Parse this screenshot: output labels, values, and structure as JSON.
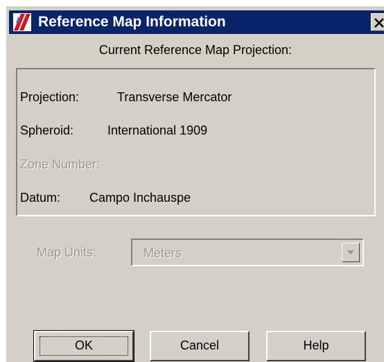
{
  "window": {
    "title": "Reference Map Information",
    "icon": "map-app-icon",
    "close_icon": "close-icon"
  },
  "heading": "Current Reference Map Projection:",
  "info": {
    "projection_label": "Projection:",
    "projection_value": "Transverse Mercator",
    "spheroid_label": "Spheroid:",
    "spheroid_value": "International 1909",
    "zone_label": "Zone Number:",
    "datum_label": "Datum:",
    "datum_value": "Campo Inchauspe"
  },
  "map_units": {
    "label": "Map Units:",
    "selected": "Meters",
    "dropdown_icon": "chevron-down-icon"
  },
  "buttons": {
    "ok": "OK",
    "cancel": "Cancel",
    "help": "Help"
  },
  "colors": {
    "titlebar": "#0a246a",
    "dialog_face": "#d4d0c8",
    "disabled_text": "#9a978f"
  }
}
